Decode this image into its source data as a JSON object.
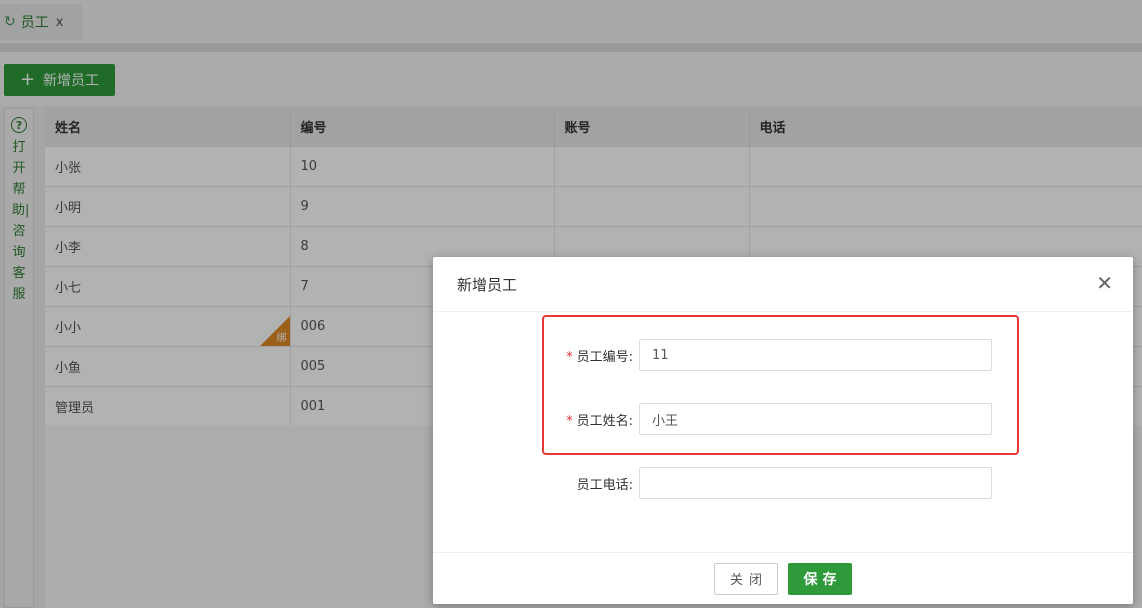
{
  "tab": {
    "title": "员工",
    "close": "x",
    "refresh_icon": "refresh-icon"
  },
  "toolbar": {
    "add_label": "新增员工",
    "accent": "#2e9a3a"
  },
  "help": {
    "label": "打开帮助|咨询客服"
  },
  "table": {
    "columns": [
      "姓名",
      "编号",
      "账号",
      "电话"
    ],
    "rows": [
      {
        "name": "小张",
        "code": "10",
        "account": "",
        "phone": ""
      },
      {
        "name": "小明",
        "code": "9",
        "account": "",
        "phone": ""
      },
      {
        "name": "小李",
        "code": "8",
        "account": "",
        "phone": ""
      },
      {
        "name": "小七",
        "code": "7",
        "account": "",
        "phone": ""
      },
      {
        "name": "小小",
        "code": "006",
        "account": "",
        "phone": "",
        "badge": "绑"
      },
      {
        "name": "小鱼",
        "code": "005",
        "account": "",
        "phone": ""
      },
      {
        "name": "管理员",
        "code": "001",
        "account": "",
        "phone": ""
      }
    ]
  },
  "modal": {
    "title": "新增员工",
    "fields": {
      "code": {
        "label": "员工编号:",
        "value": "11",
        "required": true
      },
      "name": {
        "label": "员工姓名:",
        "value": "小王",
        "required": true
      },
      "phone": {
        "label": "员工电话:",
        "value": "",
        "required": false
      }
    },
    "required_mark": "*",
    "close_label": "关闭",
    "save_label": "保存",
    "close_icon": "close-icon",
    "highlight_color": "#e53935"
  }
}
